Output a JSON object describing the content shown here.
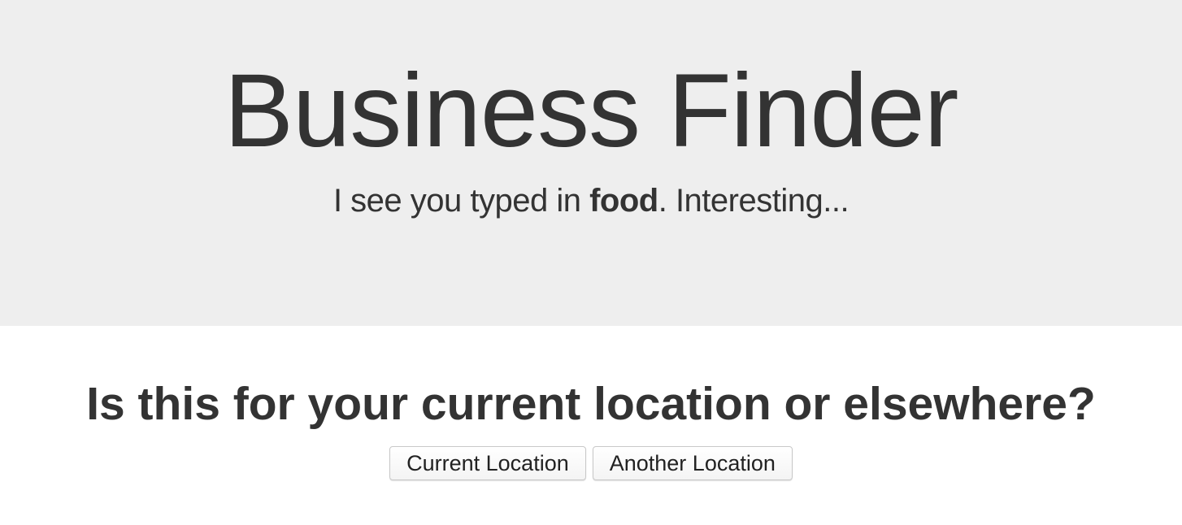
{
  "header": {
    "title": "Business Finder",
    "subtitle_prefix": "I see you typed in ",
    "query": "food",
    "subtitle_suffix": ". Interesting..."
  },
  "main": {
    "question": "Is this for your current location or elsewhere?",
    "buttons": {
      "current_location": "Current Location",
      "another_location": "Another Location"
    }
  },
  "colors": {
    "jumbotron_bg": "#eeeeee",
    "text": "#333333"
  }
}
